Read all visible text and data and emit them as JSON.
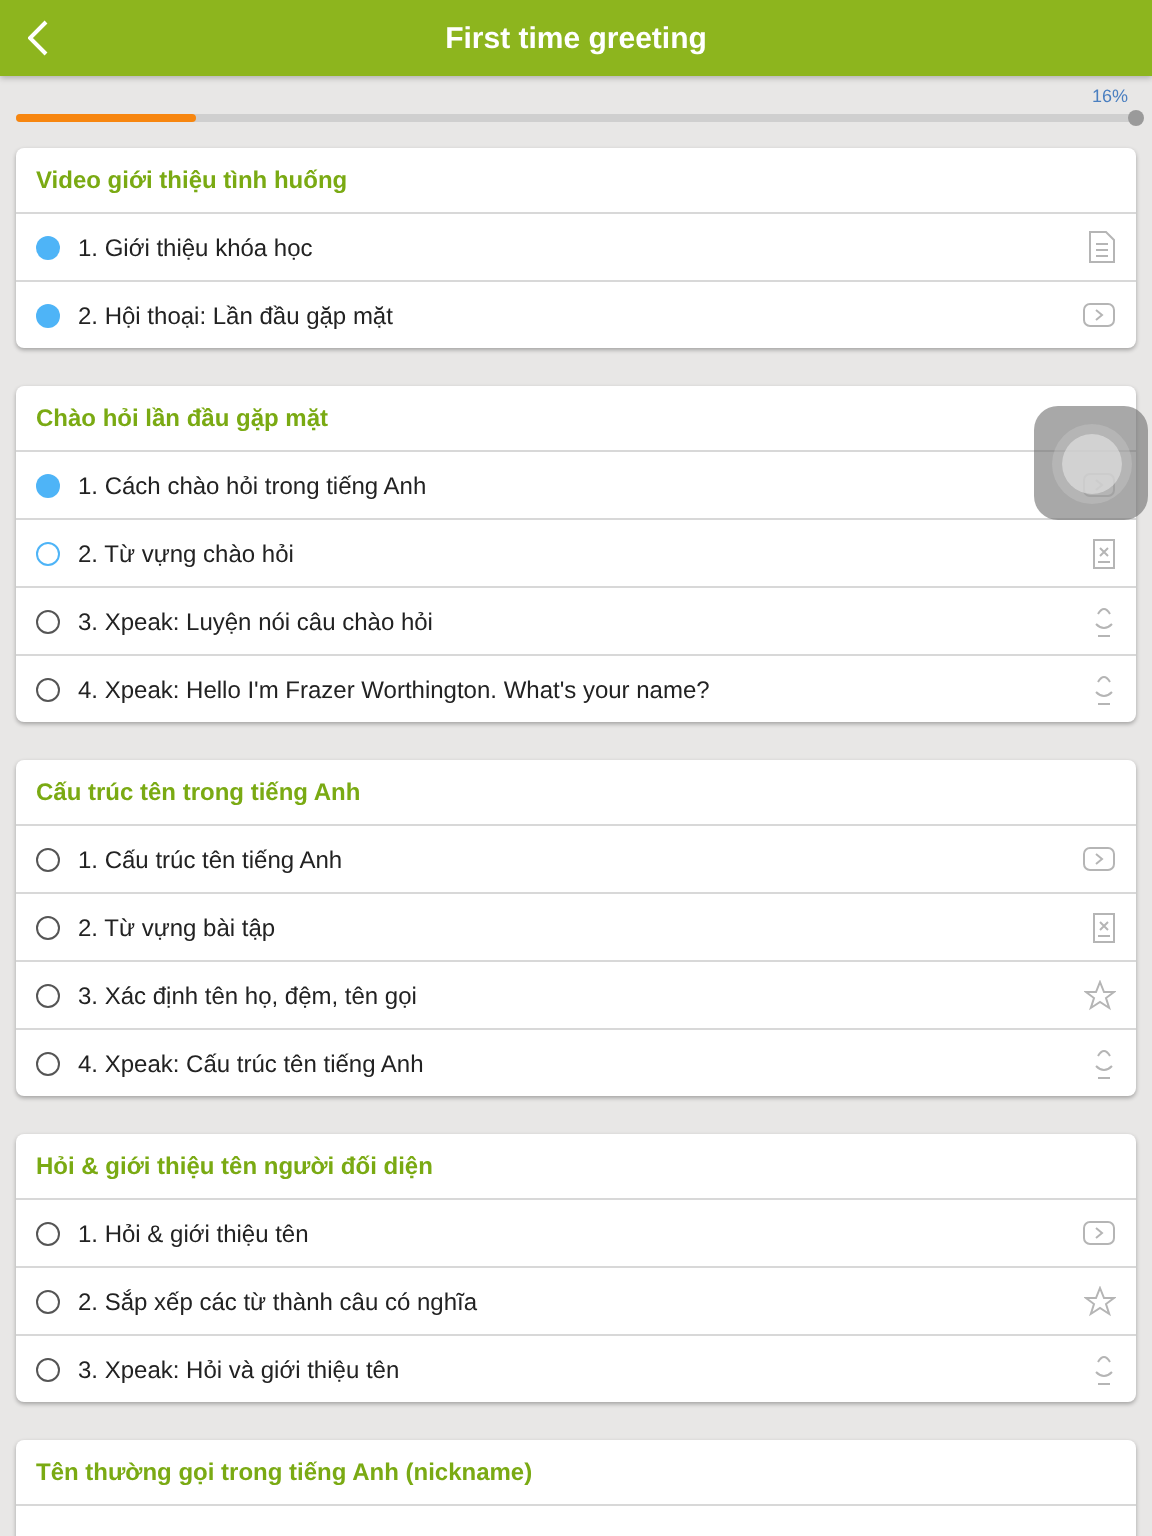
{
  "header": {
    "title": "First time greeting"
  },
  "progress": {
    "reading": "16%",
    "level": 0.16
  },
  "sections": [
    {
      "title": "Video giới thiệu tình huống",
      "lessons": [
        {
          "label": "1. Giới thiệu khóa học",
          "done": true,
          "current": false,
          "kind": "document"
        },
        {
          "label": "2. Hội thoại: Lần đầu gặp mặt",
          "done": true,
          "current": false,
          "kind": "video"
        }
      ]
    },
    {
      "title": "Chào hỏi lần đầu gặp mặt",
      "lessons": [
        {
          "label": "1. Cách chào hỏi trong tiếng Anh",
          "done": true,
          "current": false,
          "kind": "video"
        },
        {
          "label": "2. Từ vựng chào hỏi",
          "done": false,
          "current": true,
          "kind": "vocab"
        },
        {
          "label": "3. Xpeak: Luyện nói câu chào hỏi",
          "done": false,
          "current": false,
          "kind": "speak"
        },
        {
          "label": "4. Xpeak: Hello I'm Frazer Worthington. What's your name?",
          "done": false,
          "current": false,
          "kind": "speak"
        }
      ]
    },
    {
      "title": "Cấu trúc tên trong tiếng Anh",
      "lessons": [
        {
          "label": "1. Cấu trúc tên tiếng Anh",
          "done": false,
          "current": false,
          "kind": "video"
        },
        {
          "label": "2. Từ vựng bài tập",
          "done": false,
          "current": false,
          "kind": "vocab"
        },
        {
          "label": "3. Xác định tên họ, đệm, tên gọi",
          "done": false,
          "current": false,
          "kind": "quiz"
        },
        {
          "label": "4. Xpeak: Cấu trúc tên tiếng Anh",
          "done": false,
          "current": false,
          "kind": "speak"
        }
      ]
    },
    {
      "title": "Hỏi & giới thiệu tên người đối diện",
      "lessons": [
        {
          "label": "1. Hỏi & giới thiệu tên",
          "done": false,
          "current": false,
          "kind": "video"
        },
        {
          "label": "2. Sắp xếp các từ thành câu có nghĩa",
          "done": false,
          "current": false,
          "kind": "quiz"
        },
        {
          "label": "3. Xpeak: Hỏi và giới thiệu tên",
          "done": false,
          "current": false,
          "kind": "speak"
        }
      ]
    },
    {
      "title": "Tên thường gọi trong tiếng Anh (nickname)"
    }
  ]
}
